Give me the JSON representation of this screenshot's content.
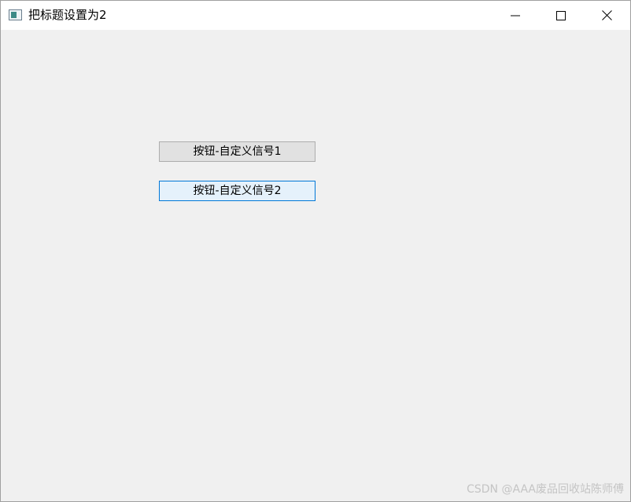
{
  "window": {
    "title": "把标题设置为2",
    "controls": {
      "minimize_icon": "minimize-icon",
      "maximize_icon": "maximize-icon",
      "close_icon": "close-icon"
    }
  },
  "buttons": [
    {
      "label": "按钮-自定义信号1"
    },
    {
      "label": "按钮-自定义信号2",
      "state": "focused"
    }
  ],
  "watermark": "CSDN @AAA废品回收站陈师傅",
  "colors": {
    "window_background": "#f0f0f0",
    "titlebar_background": "#ffffff",
    "button_background": "#e1e1e1",
    "button_border": "#adadad",
    "focused_button_background": "#e5f1fb",
    "focused_button_border": "#0078d7"
  }
}
